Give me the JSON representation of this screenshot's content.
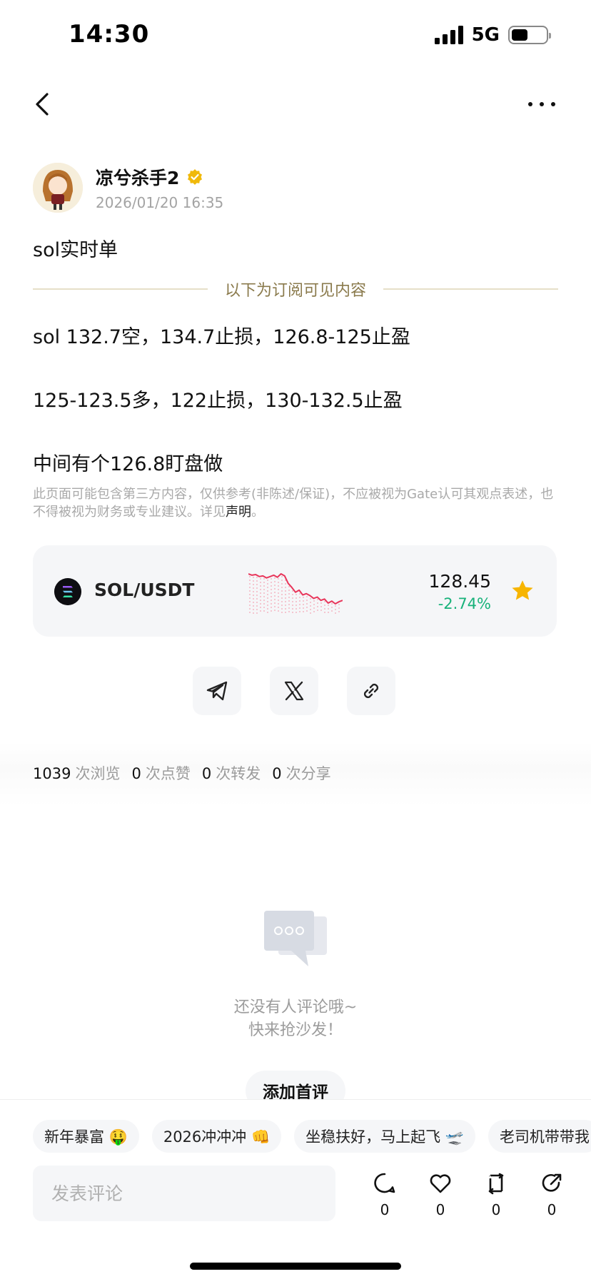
{
  "status_bar": {
    "time": "14:30",
    "network": "5G",
    "battery_level": 0.4
  },
  "nav": {
    "back_icon": "chevron-left-icon",
    "more_icon": "more-horizontal-icon"
  },
  "author": {
    "name": "凉兮杀手2",
    "time": "2026/01/20 16:35",
    "verified_color": "#f0b90b"
  },
  "post": {
    "title": "sol实时单",
    "divider_text": "以下为订阅可见内容",
    "lines": [
      "sol  132.7空，134.7止损，126.8-125止盈",
      "125-123.5多，122止损，130-132.5止盈",
      "中间有个126.8盯盘做"
    ],
    "disclaimer": "此页面可能包含第三方内容，仅供参考(非陈述/保证)，不应被视为Gate认可其观点表述，也不得被视为财务或专业建议。详见",
    "disclaimer_link": "声明",
    "disclaimer_end": "。"
  },
  "market": {
    "pair": "SOL/USDT",
    "price": "128.45",
    "change": "-2.74%",
    "change_color": "#18b27a",
    "sparkline": [
      132.6,
      132.4,
      132.5,
      132.2,
      132.3,
      132.0,
      132.2,
      132.4,
      132.1,
      132.6,
      132.3,
      131.2,
      130.6,
      129.9,
      130.2,
      129.5,
      129.7,
      129.4,
      129.0,
      129.2,
      128.7,
      128.9,
      128.3,
      128.6,
      128.2,
      128.5,
      128.7
    ]
  },
  "share": {
    "icons": [
      "telegram-icon",
      "x-icon",
      "link-icon"
    ]
  },
  "stats": {
    "views": "1039",
    "views_label": "次浏览",
    "likes": "0",
    "likes_label": "次点赞",
    "reposts": "0",
    "reposts_label": "次转发",
    "shares": "0",
    "shares_label": "次分享"
  },
  "empty": {
    "line1": "还没有人评论哦~",
    "line2": "快来抢沙发！",
    "button": "添加首评"
  },
  "chips": [
    "新年暴富 🤑",
    "2026冲冲冲 👊",
    "坐稳扶好，马上起飞 🛫",
    "老司机带带我"
  ],
  "composer": {
    "placeholder": "发表评论",
    "comment_count": "0",
    "like_count": "0",
    "repost_count": "0",
    "share_count": "0"
  }
}
